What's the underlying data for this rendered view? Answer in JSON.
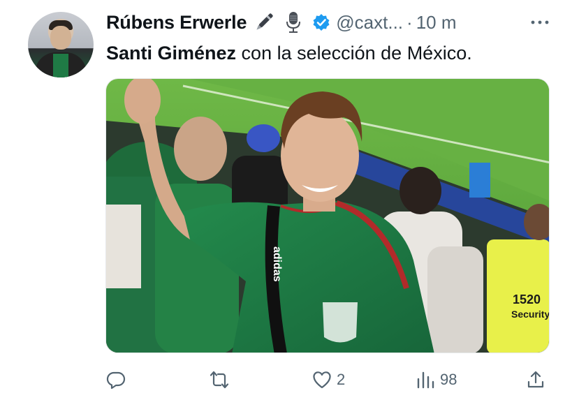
{
  "tweet": {
    "author": {
      "display_name": "Rúbens Erwerle",
      "name_emojis": [
        "pen-icon",
        "microphone-icon"
      ],
      "handle": "@caxt...",
      "separator": "·",
      "time": "10 m"
    },
    "text_bold": "Santi Giménez",
    "text_rest": " con la selección de México.",
    "photo": {
      "jersey_wordmark": "adidas",
      "badge_number": "1520",
      "badge_label": "Security"
    },
    "actions": {
      "replies": "",
      "retweets": "",
      "likes": "2",
      "views": "98"
    }
  },
  "colors": {
    "text": "#0f1419",
    "secondary": "#536471",
    "verified": "#1d9bf0",
    "jersey_green": "#1f7a45",
    "pitch_green": "#5fa83f"
  }
}
